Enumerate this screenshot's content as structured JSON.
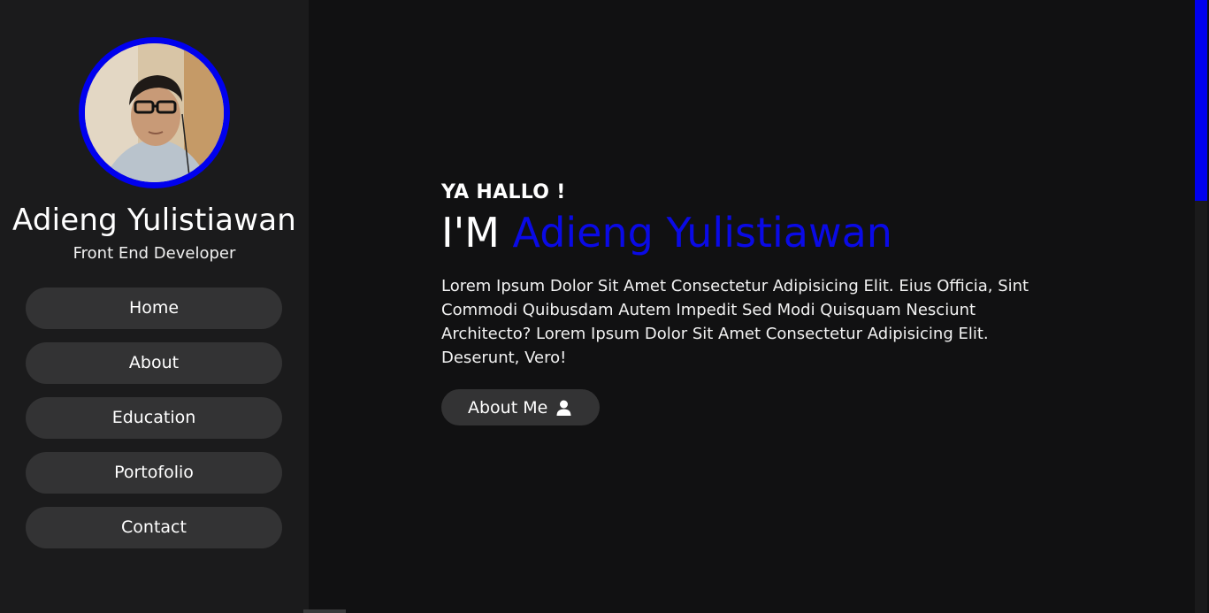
{
  "profile": {
    "name": "Adieng Yulistiawan",
    "role": "Front End Developer",
    "avatar_ring_color": "#0000ee"
  },
  "nav": {
    "items": [
      {
        "label": "Home"
      },
      {
        "label": "About"
      },
      {
        "label": "Education"
      },
      {
        "label": "Portofolio"
      },
      {
        "label": "Contact"
      }
    ]
  },
  "hero": {
    "greeting": "YA HALLO !",
    "title_prefix": "I'M",
    "title_name": "Adieng Yulistiawan",
    "description": "Lorem Ipsum Dolor Sit Amet Consectetur Adipisicing Elit. Eius Officia, Sint Commodi Quibusdam Autem Impedit Sed Modi Quisquam Nesciunt Architecto? Lorem Ipsum Dolor Sit Amet Consectetur Adipisicing Elit. Deserunt, Vero!",
    "button_label": "About Me",
    "button_icon": "user-icon",
    "accent_color": "#0a0ae6"
  },
  "scrollbar": {
    "thumb_color": "#0000ee"
  }
}
